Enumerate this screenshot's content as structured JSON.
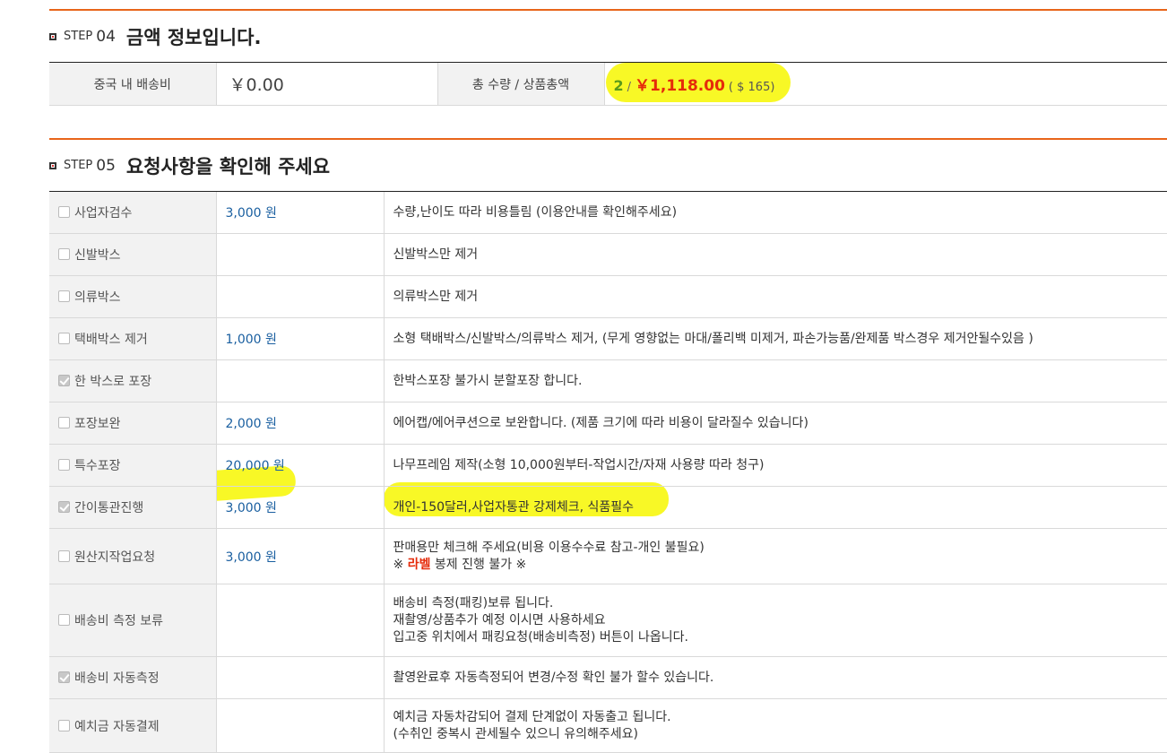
{
  "step04": {
    "step_label": "STEP",
    "step_num": "04",
    "title": "금액 정보입니다.",
    "shipping_label": "중국 내 배송비",
    "shipping_value": "￥0.00",
    "total_label": "총 수량 / 상품총액",
    "qty": "2",
    "slash": "/",
    "price": "￥1,118.00",
    "usd": "( $ 165)"
  },
  "step05": {
    "step_label": "STEP",
    "step_num": "05",
    "title": "요청사항을 확인해 주세요",
    "rows": [
      {
        "label": "사업자검수",
        "checked": false,
        "cost": "3,000 원",
        "desc": [
          "수량,난이도 따라 비용틀림 (이용안내를 확인해주세요)"
        ]
      },
      {
        "label": "신발박스",
        "checked": false,
        "cost": "",
        "desc": [
          "신발박스만 제거"
        ]
      },
      {
        "label": "의류박스",
        "checked": false,
        "cost": "",
        "desc": [
          "의류박스만 제거"
        ]
      },
      {
        "label": "택배박스 제거",
        "checked": false,
        "cost": "1,000 원",
        "desc": [
          "소형 택배박스/신발박스/의류박스 제거, (무게 영향없는 마대/폴리백 미제거, 파손가능품/완제품 박스경우 제거안될수있음 )"
        ]
      },
      {
        "label": "한 박스로 포장",
        "checked": true,
        "cost": "",
        "desc": [
          "한박스포장 불가시 분할포장 합니다."
        ]
      },
      {
        "label": "포장보완",
        "checked": false,
        "cost": "2,000 원",
        "desc": [
          "에어캡/에어쿠션으로 보완합니다. (제품 크기에 따라 비용이 달라질수 있습니다)"
        ]
      },
      {
        "label": "특수포장",
        "checked": false,
        "cost": "20,000 원",
        "desc": [
          "나무프레임 제작(소형 10,000원부터-작업시간/자재 사용량 따라 청구)"
        ]
      },
      {
        "label": "간이통관진행",
        "checked": true,
        "cost": "3,000 원",
        "desc": [
          "개인-150달러,사업자통관 강제체크, 식품필수"
        ]
      },
      {
        "label": "원산지작업요청",
        "checked": false,
        "cost": "3,000 원",
        "desc": [
          "판매용만 체크해 주세요(비용 이용수수료 참고-개인 불필요)"
        ],
        "note_prefix": "※ ",
        "note_red": "라벨",
        "note_suffix": " 봉제 진행 불가 ※"
      },
      {
        "label": "배송비 측정 보류",
        "checked": false,
        "cost": "",
        "desc": [
          "배송비 측정(패킹)보류 됩니다.",
          "재촬영/상품추가 예정 이시면 사용하세요",
          "입고중 위치에서 패킹요청(배송비측정) 버튼이 나옵니다."
        ]
      },
      {
        "label": "배송비 자동측정",
        "checked": true,
        "cost": "",
        "desc": [
          "촬영완료후 자동측정되어 변경/수정 확인 불가 할수 있습니다."
        ]
      },
      {
        "label": "예치금 자동결제",
        "checked": false,
        "cost": "",
        "desc": [
          "예치금 자동차감되어 결제 단계없이 자동출고 됩니다.",
          "(수취인 중복시 관세될수 있으니 유의해주세요)"
        ]
      }
    ]
  }
}
